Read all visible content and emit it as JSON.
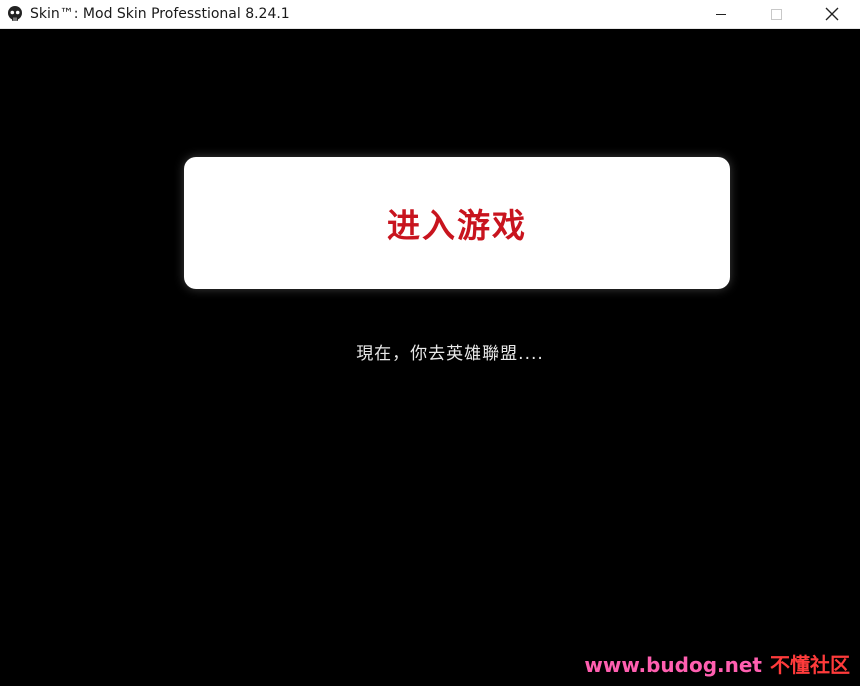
{
  "window": {
    "title": "Skin™: Mod Skin Professtional 8.24.1",
    "icon": "skull-icon",
    "controls": {
      "minimize": "minimize-icon",
      "maximize": "maximize-icon",
      "close": "close-icon"
    }
  },
  "main": {
    "enter_button_label": "进入游戏",
    "status_text": "現在，你去英雄聯盟....",
    "accent_color": "#c8141e"
  },
  "watermark": {
    "url": "www.budog.net",
    "site_name": "不懂社区"
  }
}
